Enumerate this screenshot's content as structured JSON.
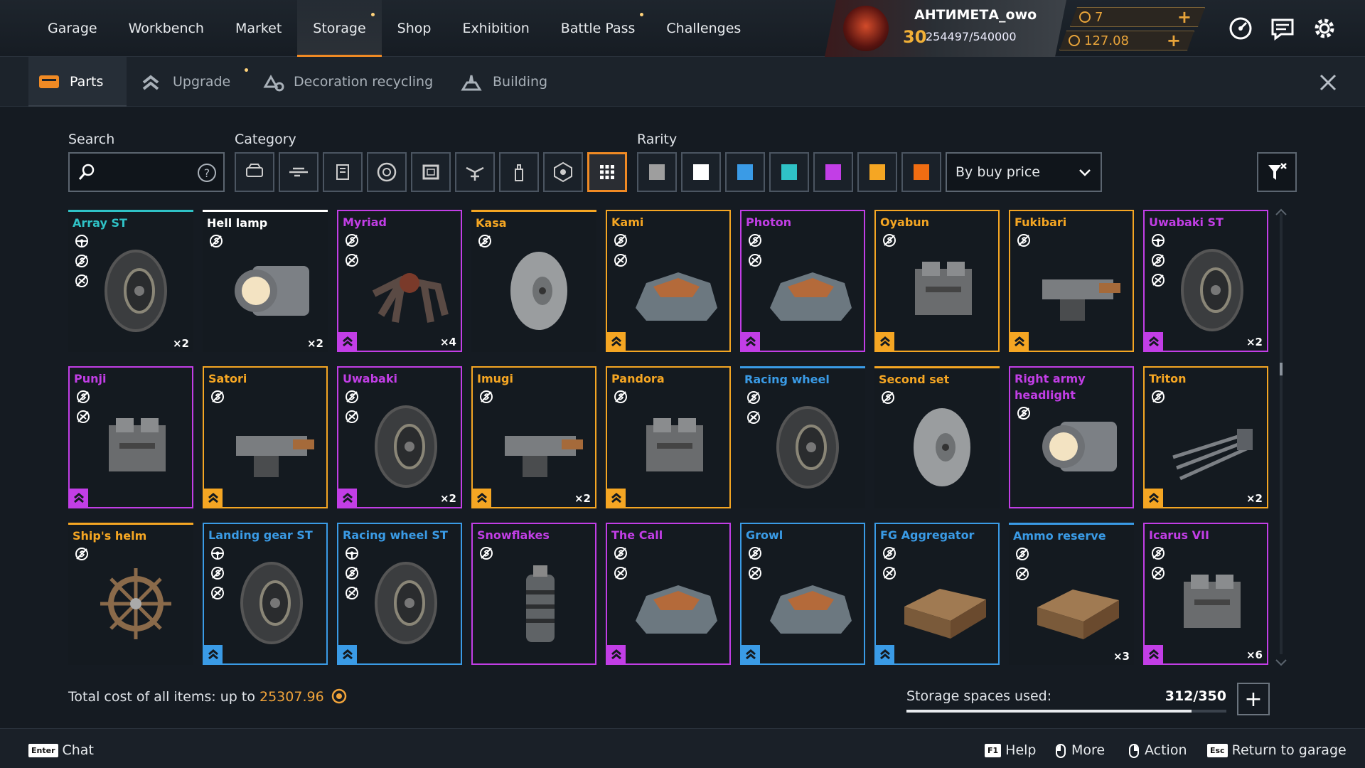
{
  "colors": {
    "accent": "#f08a24",
    "common": "#9e9e9e",
    "rare": "#3a9be6",
    "special": "#2fc2c6",
    "epic": "#c23ee6",
    "legendary": "#f5a623",
    "relic": "#f06d12",
    "white": "#ffffff"
  },
  "nav": {
    "tabs": [
      "Garage",
      "Workbench",
      "Market",
      "Storage",
      "Shop",
      "Exhibition",
      "Battle Pass",
      "Challenges"
    ],
    "active": "Storage"
  },
  "profile": {
    "name": "АНТИМЕТА_owo",
    "level": "30",
    "xp": "254497/540000"
  },
  "currency": {
    "coins": "7",
    "credits": "127.08"
  },
  "subtabs": [
    {
      "label": "Parts"
    },
    {
      "label": "Upgrade"
    },
    {
      "label": "Decoration recycling"
    },
    {
      "label": "Building"
    }
  ],
  "filters": {
    "search_label": "Search",
    "category_label": "Category",
    "rarity_label": "Rarity",
    "categories": [
      "cabins-icon",
      "weapons-icon",
      "hardware-icon",
      "wheels-icon",
      "frames-icon",
      "decor-icon",
      "paint-icon",
      "module-icon",
      "all-icon"
    ],
    "rarities": [
      "#9e9e9e",
      "#ffffff",
      "#3a9be6",
      "#2fc2c6",
      "#c23ee6",
      "#f5a623",
      "#f06d12"
    ],
    "sort": "By buy price"
  },
  "items": [
    {
      "name": "Array ST",
      "rarity": "special",
      "icons": [
        "steer",
        "nosell",
        "nocraft"
      ],
      "qty": "×2",
      "upgrade": false,
      "art": "wheel"
    },
    {
      "name": "Hell lamp",
      "rarity": "white",
      "icons": [
        "nosell"
      ],
      "qty": "×2",
      "upgrade": false,
      "art": "lamp"
    },
    {
      "name": "Myriad",
      "rarity": "epic",
      "icons": [
        "nosell",
        "nocraft"
      ],
      "qty": "×4",
      "upgrade": true,
      "art": "spider"
    },
    {
      "name": "Kasa",
      "rarity": "legendary",
      "icons": [
        "nosell"
      ],
      "qty": "",
      "upgrade": false,
      "art": "disc"
    },
    {
      "name": "Kami",
      "rarity": "legendary",
      "icons": [
        "nosell",
        "nocraft"
      ],
      "qty": "",
      "upgrade": true,
      "art": "cabin"
    },
    {
      "name": "Photon",
      "rarity": "epic",
      "icons": [
        "nosell",
        "nocraft"
      ],
      "qty": "",
      "upgrade": true,
      "art": "cabin"
    },
    {
      "name": "Oyabun",
      "rarity": "legendary",
      "icons": [
        "nosell"
      ],
      "qty": "",
      "upgrade": true,
      "art": "engine"
    },
    {
      "name": "Fukibari",
      "rarity": "legendary",
      "icons": [
        "nosell"
      ],
      "qty": "",
      "upgrade": true,
      "art": "gun"
    },
    {
      "name": "Uwabaki ST",
      "rarity": "epic",
      "icons": [
        "steer",
        "nosell",
        "nocraft"
      ],
      "qty": "×2",
      "upgrade": true,
      "art": "wheel"
    },
    {
      "name": "Punji",
      "rarity": "epic",
      "icons": [
        "nosell",
        "nocraft"
      ],
      "qty": "",
      "upgrade": true,
      "art": "engine"
    },
    {
      "name": "Satori",
      "rarity": "legendary",
      "icons": [
        "nosell"
      ],
      "qty": "",
      "upgrade": true,
      "art": "gun"
    },
    {
      "name": "Uwabaki",
      "rarity": "epic",
      "icons": [
        "nosell",
        "nocraft"
      ],
      "qty": "×2",
      "upgrade": true,
      "art": "wheel"
    },
    {
      "name": "Imugi",
      "rarity": "legendary",
      "icons": [
        "nosell"
      ],
      "qty": "×2",
      "upgrade": true,
      "art": "gun"
    },
    {
      "name": "Pandora",
      "rarity": "legendary",
      "icons": [
        "nosell"
      ],
      "qty": "",
      "upgrade": true,
      "art": "engine"
    },
    {
      "name": "Racing wheel",
      "rarity": "rare",
      "icons": [
        "nosell",
        "nocraft"
      ],
      "qty": "",
      "upgrade": false,
      "art": "wheel"
    },
    {
      "name": "Second set",
      "rarity": "legendary",
      "icons": [
        "nosell"
      ],
      "qty": "",
      "upgrade": false,
      "art": "disc"
    },
    {
      "name": "Right army headlight",
      "rarity": "epic",
      "icons": [
        "nosell"
      ],
      "qty": "",
      "upgrade": false,
      "art": "lamp"
    },
    {
      "name": "Triton",
      "rarity": "legendary",
      "icons": [
        "nosell"
      ],
      "qty": "×2",
      "upgrade": true,
      "art": "spikes"
    },
    {
      "name": "Ship's helm",
      "rarity": "legendary",
      "icons": [
        "nosell"
      ],
      "qty": "",
      "upgrade": false,
      "art": "helm"
    },
    {
      "name": "Landing gear ST",
      "rarity": "rare",
      "icons": [
        "steer",
        "nosell",
        "nocraft"
      ],
      "qty": "",
      "upgrade": true,
      "art": "wheel"
    },
    {
      "name": "Racing wheel ST",
      "rarity": "rare",
      "icons": [
        "steer",
        "nosell",
        "nocraft"
      ],
      "qty": "",
      "upgrade": true,
      "art": "wheel"
    },
    {
      "name": "Snowflakes",
      "rarity": "epic",
      "icons": [
        "nosell"
      ],
      "qty": "",
      "upgrade": false,
      "art": "can"
    },
    {
      "name": "The Call",
      "rarity": "epic",
      "icons": [
        "nosell",
        "nocraft"
      ],
      "qty": "",
      "upgrade": true,
      "art": "cabin"
    },
    {
      "name": "Growl",
      "rarity": "rare",
      "icons": [
        "nosell",
        "nocraft"
      ],
      "qty": "",
      "upgrade": true,
      "art": "cabin"
    },
    {
      "name": "FG Aggregator",
      "rarity": "rare",
      "icons": [
        "nosell",
        "nocraft"
      ],
      "qty": "",
      "upgrade": true,
      "art": "box"
    },
    {
      "name": "Ammo reserve",
      "rarity": "rare",
      "icons": [
        "nosell",
        "nocraft"
      ],
      "qty": "×3",
      "upgrade": false,
      "art": "box"
    },
    {
      "name": "Icarus VII",
      "rarity": "epic",
      "icons": [
        "nosell",
        "nocraft"
      ],
      "qty": "×6",
      "upgrade": true,
      "art": "engine"
    }
  ],
  "footer": {
    "total_label": "Total cost of all items: up to",
    "total_value": "25307.96",
    "storage_label": "Storage spaces used:",
    "storage_value": "312/350",
    "storage_fraction": 0.8914
  },
  "hints": [
    {
      "key": "Enter",
      "label": "Chat"
    },
    {
      "key": "F1",
      "label": "Help"
    },
    {
      "mouse": "left",
      "label": "More"
    },
    {
      "mouse": "right",
      "label": "Action"
    },
    {
      "key": "Esc",
      "label": "Return to garage"
    }
  ]
}
